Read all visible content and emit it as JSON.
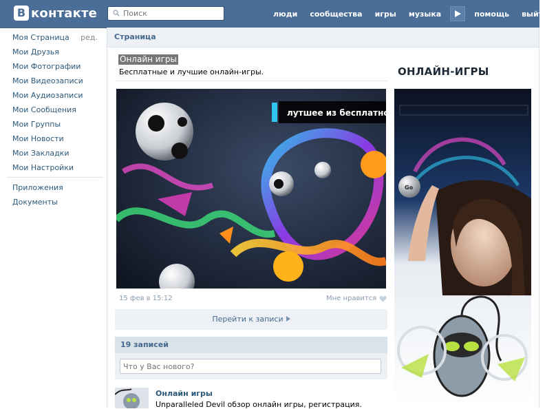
{
  "header": {
    "logo_mark": "В",
    "logo_text": "контакте",
    "search_placeholder": "Поиск",
    "nav": [
      "люди",
      "сообщества",
      "игры",
      "музыка",
      "помощь",
      "выйти"
    ],
    "bg_color": "#4a6e98"
  },
  "left_menu": {
    "items": [
      "Моя Страница",
      "Мои Друзья",
      "Мои Фотографии",
      "Мои Видеозаписи",
      "Мои Аудиозаписи",
      "Мои Сообщения",
      "Мои Группы",
      "Мои Новости",
      "Мои Закладки",
      "Мои Настройки"
    ],
    "edit_label": "ред.",
    "extra_items": [
      "Приложения",
      "Документы"
    ],
    "link_color": "#2b587a"
  },
  "page": {
    "section_title": "Страница",
    "group_name": "Онлайн игры",
    "group_description": "Бесплатные и лучшие онлайн-игры.",
    "post_image_caption": "лутшее из бесплатного",
    "post_date": "15 фев в 15:12",
    "like_label": "Мне нравится",
    "goto_label": "Перейти к записи",
    "wall_count": "19 записей",
    "wall_placeholder": "Что у Вас нового?",
    "last_post_author": "Онлайн игры",
    "last_post_text": "Unparalleled Devil обзор онлайн игры, регистрация."
  },
  "sidebar": {
    "title": "ОНЛАЙН-ИГРЫ",
    "banner_button": "Go"
  }
}
